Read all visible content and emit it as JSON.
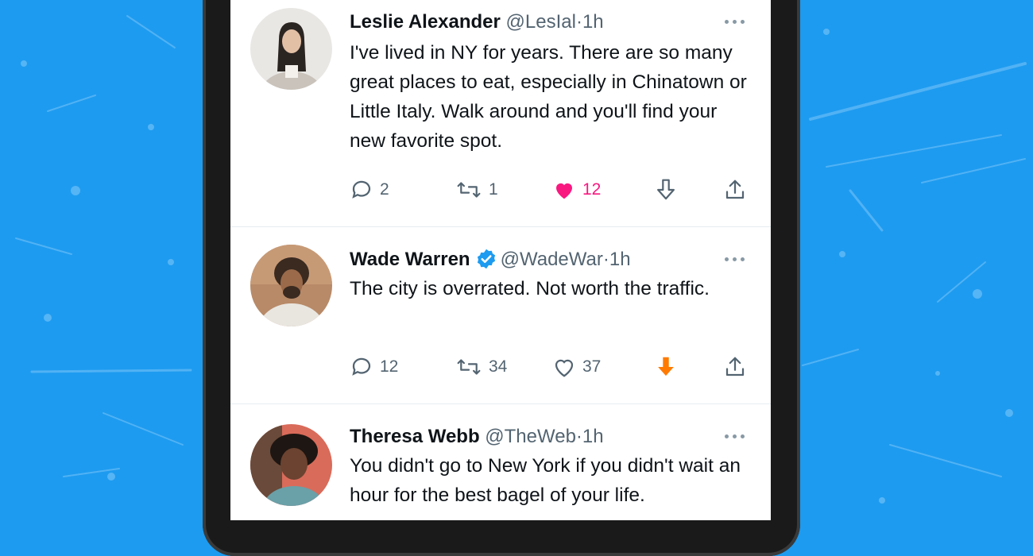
{
  "tweets": [
    {
      "name": "Leslie Alexander",
      "handle": "@LesIal",
      "dot": "·",
      "time": "1h",
      "text": "I've lived in NY for years. There are so many great places to eat, especially in Chinatown or Little Italy. Walk around and you'll find your new favorite spot.",
      "verified": false,
      "replies": "2",
      "retweets": "1",
      "likes": "12",
      "liked": true,
      "downvoted": false
    },
    {
      "name": "Wade Warren",
      "handle": "@WadeWar",
      "dot": "·",
      "time": "1h",
      "text": "The city is overrated. Not worth the traffic.",
      "verified": true,
      "replies": "12",
      "retweets": "34",
      "likes": "37",
      "liked": false,
      "downvoted": true
    },
    {
      "name": "Theresa Webb",
      "handle": "@TheWeb",
      "dot": "·",
      "time": "1h",
      "text": "You didn't go to New York if you didn't wait an hour for the best bagel of your life.",
      "verified": false
    }
  ],
  "icons": {
    "reply": "reply-icon",
    "retweet": "retweet-icon",
    "like": "heart-icon",
    "downvote": "downvote-arrow-icon",
    "share": "share-icon",
    "more": "more-icon",
    "verified": "verified-badge-icon"
  },
  "colors": {
    "background": "#1d9bf0",
    "like_active": "#f91880",
    "downvote_active": "#ff7a00",
    "verified": "#1d9bf0"
  }
}
